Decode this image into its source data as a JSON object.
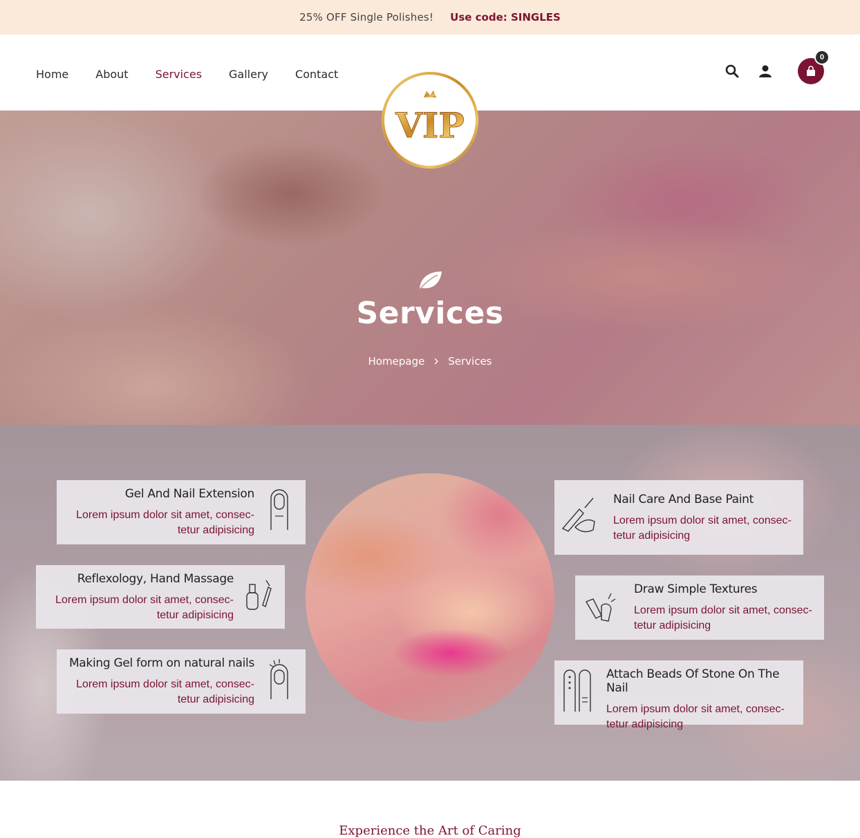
{
  "promo": {
    "message": "25% OFF Single Polishes!",
    "code": "Use code: SINGLES"
  },
  "nav": {
    "items": [
      {
        "label": "Home",
        "active": false
      },
      {
        "label": "About",
        "active": false
      },
      {
        "label": "Services",
        "active": true
      },
      {
        "label": "Gallery",
        "active": false
      },
      {
        "label": "Contact",
        "active": false
      }
    ]
  },
  "header": {
    "icons": [
      "search-icon",
      "user-icon",
      "shopping-bag-icon"
    ],
    "cart_count": "0",
    "logo_text": "VIP"
  },
  "hero": {
    "title": "Services",
    "breadcrumbs": [
      "Homepage",
      "Services"
    ]
  },
  "services": {
    "left": [
      {
        "title": "Gel And Nail Extension",
        "desc": "Lorem ipsum dolor sit amet, consec-tetur adipisicing",
        "icon": "nail-finger-icon"
      },
      {
        "title": "Reflexology, Hand Massage",
        "desc": "Lorem ipsum dolor sit amet, consec-tetur adipisicing",
        "icon": "nail-polish-bottles-icon"
      },
      {
        "title": "Making Gel form on natural nails",
        "desc": "Lorem ipsum dolor sit amet, consec-tetur adipisicing",
        "icon": "finger-sparkle-icon"
      }
    ],
    "right": [
      {
        "title": "Nail Care And Base Paint",
        "desc": "Lorem ipsum dolor sit amet, consec-tetur adipisicing",
        "icon": "nail-brush-icon"
      },
      {
        "title": "Draw Simple Textures",
        "desc": "Lorem ipsum dolor sit amet, consec-tetur adipisicing",
        "icon": "hand-texture-icon"
      },
      {
        "title": "Attach Beads Of Stone On The Nail",
        "desc": "Lorem ipsum dolor sit amet, consec-tetur adipisicing",
        "icon": "beaded-fingers-icon"
      }
    ]
  },
  "below": {
    "tagline": "Experience the Art of Caring"
  },
  "colors": {
    "brand": "#7a1432",
    "promo_bg": "#fbe9da",
    "card_bg": "#e9e5ea"
  }
}
